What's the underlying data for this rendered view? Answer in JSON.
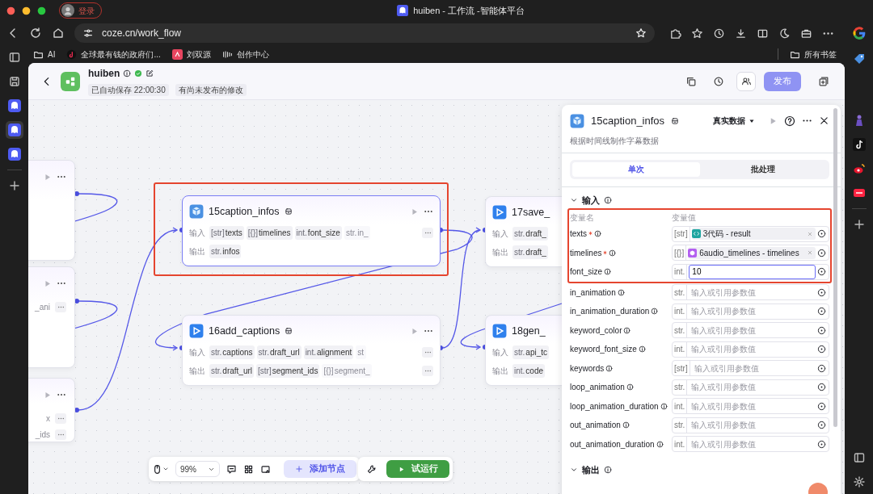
{
  "browser": {
    "profile_label": "登录",
    "tab_title": "huiben - 工作流 -智能体平台",
    "url": "coze.cn/work_flow",
    "bookmarks": [
      {
        "label": "AI",
        "kind": "folder"
      },
      {
        "label": "全球最有钱的政府们...",
        "kind": "douyin"
      },
      {
        "label": "刘双源",
        "kind": "app"
      },
      {
        "label": "创作中心",
        "kind": "bars"
      }
    ],
    "all_bookmarks": "所有书签",
    "left_sidebar": [
      {
        "kind": "panel",
        "selected": false
      },
      {
        "kind": "save",
        "selected": false
      },
      {
        "kind": "coze",
        "selected": false
      },
      {
        "kind": "coze",
        "selected": true
      },
      {
        "kind": "coze",
        "selected": false
      },
      {
        "kind": "add",
        "selected": false
      }
    ],
    "right_sidebar": [
      {
        "kind": "tag"
      },
      {
        "kind": "figure"
      },
      {
        "kind": "tiktok"
      },
      {
        "kind": "weibo"
      },
      {
        "kind": "redbook"
      },
      {
        "kind": "add"
      },
      {
        "kind": "panel"
      },
      {
        "kind": "gear"
      }
    ]
  },
  "header": {
    "title": "huiben",
    "autosave": "已自动保存 22:00:30",
    "status": "有尚未发布的修改",
    "publish": {
      "label": "发布",
      "disabled": true
    }
  },
  "stub_nodes": [
    {
      "selected": false
    },
    {
      "selected": false,
      "rows": [
        {
          "text": "_ani",
          "more": true
        }
      ]
    },
    {
      "selected": false,
      "rows": [
        {
          "text": "x",
          "more": true
        },
        {
          "text": "_ids",
          "more": true
        }
      ]
    }
  ],
  "nodes": [
    {
      "title": "15caption_infos",
      "kind": "cube",
      "selected": true,
      "highlighted": true,
      "in_label": "输入",
      "out_label": "输出",
      "inputs_more": true,
      "outputs_more": false,
      "inputs": [
        {
          "type": "[str]",
          "name": "texts",
          "faded": false
        },
        {
          "type": "[{}]",
          "name": "timelines",
          "faded": false
        },
        {
          "type": "int.",
          "name": "font_size",
          "faded": false
        },
        {
          "type": "str.",
          "name": "in_",
          "faded": true
        }
      ],
      "outputs": [
        {
          "type": "str.",
          "name": "infos",
          "faded": false
        }
      ]
    },
    {
      "title": "16add_captions",
      "kind": "play",
      "selected": false,
      "highlighted": false,
      "in_label": "输入",
      "out_label": "输出",
      "inputs_more": true,
      "outputs_more": true,
      "inputs": [
        {
          "type": "str.",
          "name": "captions",
          "faded": false
        },
        {
          "type": "str.",
          "name": "draft_url",
          "faded": false
        },
        {
          "type": "int.",
          "name": "alignment",
          "faded": false
        },
        {
          "type": "st",
          "faded": true
        }
      ],
      "outputs": [
        {
          "type": "str.",
          "name": "draft_url",
          "faded": false
        },
        {
          "type": "[str]",
          "name": "segment_ids",
          "faded": false
        },
        {
          "type": "[{}]",
          "name": "segment_",
          "faded": true
        }
      ]
    },
    {
      "title": "17save_",
      "kind": "play",
      "selected": false,
      "highlighted": false,
      "in_label": "输入",
      "out_label": "输出",
      "inputs_more": false,
      "outputs_more": false,
      "inputs": [
        {
          "type": "str.",
          "name": "draft_",
          "faded": false
        }
      ],
      "outputs": [
        {
          "type": "str.",
          "name": "draft_",
          "faded": false
        }
      ]
    },
    {
      "title": "18gen_",
      "kind": "play",
      "selected": false,
      "highlighted": false,
      "in_label": "输入",
      "out_label": "输出",
      "inputs_more": false,
      "outputs_more": false,
      "inputs": [
        {
          "type": "str.",
          "name": "api_tc",
          "faded": false
        }
      ],
      "outputs": [
        {
          "type": "int.",
          "name": "code",
          "faded": false
        }
      ]
    }
  ],
  "toolbar": {
    "zoom": "99%",
    "add_node": "添加节点",
    "test_run": "试运行"
  },
  "panel": {
    "title": "15caption_infos",
    "kind": "cube",
    "data_mode": "真实数据",
    "description": "根据时间线制作字幕数据",
    "tabs": [
      {
        "label": "单次",
        "selected": true
      },
      {
        "label": "批处理",
        "selected": false
      }
    ],
    "input_section": {
      "title": "输入",
      "expanded": true
    },
    "col_name": "变量名",
    "col_value": "变量值",
    "params": [
      {
        "name": "texts",
        "required": true,
        "type": "[str]",
        "kind": "code",
        "color": "#1fa5a0",
        "ref_text": "3代码 - result",
        "highlighted": true
      },
      {
        "name": "timelines",
        "required": true,
        "type": "[{}]",
        "kind": "cube",
        "color": "#b35ff0",
        "ref_text": "6audio_timelines - timelines",
        "highlighted": true
      },
      {
        "name": "font_size",
        "required": false,
        "type": "int.",
        "kind": "input",
        "value": "10",
        "focused": true,
        "highlighted": true
      },
      {
        "name": "in_animation",
        "required": false,
        "type": "str.",
        "kind": "input",
        "placeholder": "输入或引用参数值",
        "focused": false,
        "highlighted": false
      },
      {
        "name": "in_animation_duration",
        "required": false,
        "type": "int.",
        "kind": "input",
        "placeholder": "输入或引用参数值",
        "focused": false,
        "highlighted": false
      },
      {
        "name": "keyword_color",
        "required": false,
        "type": "str.",
        "kind": "input",
        "placeholder": "输入或引用参数值",
        "focused": false,
        "highlighted": false
      },
      {
        "name": "keyword_font_size",
        "required": false,
        "type": "int.",
        "kind": "input",
        "placeholder": "输入或引用参数值",
        "focused": false,
        "highlighted": false
      },
      {
        "name": "keywords",
        "required": false,
        "type": "[str]",
        "kind": "input",
        "placeholder": "输入或引用参数值",
        "focused": false,
        "highlighted": false
      },
      {
        "name": "loop_animation",
        "required": false,
        "type": "str.",
        "kind": "input",
        "placeholder": "输入或引用参数值",
        "focused": false,
        "highlighted": false
      },
      {
        "name": "loop_animation_duration",
        "required": false,
        "type": "int.",
        "kind": "input",
        "placeholder": "输入或引用参数值",
        "focused": false,
        "highlighted": false
      },
      {
        "name": "out_animation",
        "required": false,
        "type": "str.",
        "kind": "input",
        "placeholder": "输入或引用参数值",
        "focused": false,
        "highlighted": false
      },
      {
        "name": "out_animation_duration",
        "required": false,
        "type": "int.",
        "kind": "input",
        "placeholder": "输入或引用参数值",
        "focused": false,
        "highlighted": false
      }
    ],
    "output_section": {
      "title": "输出",
      "expanded": true
    }
  }
}
